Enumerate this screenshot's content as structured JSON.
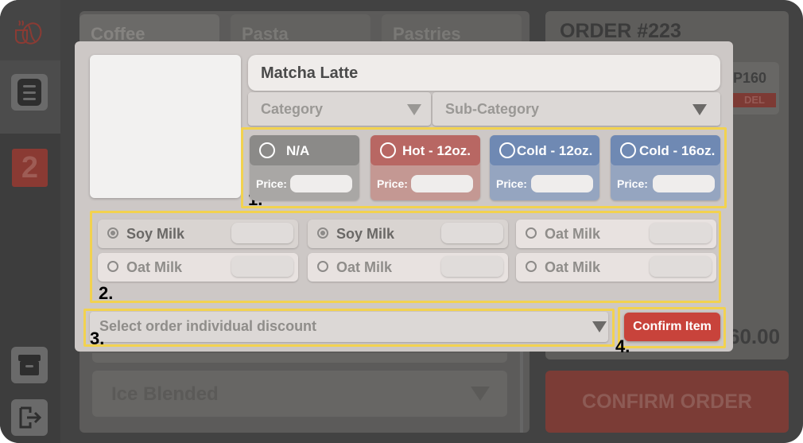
{
  "modal": {
    "item_name": "Matcha Latte",
    "category_placeholder": "Category",
    "subcategory_placeholder": "Sub-Category",
    "sizes": [
      {
        "label": "N/A",
        "price_label": "Price:",
        "color": "#8b8a88"
      },
      {
        "label": "Hot - 12oz.",
        "price_label": "Price:",
        "color": "#b86763"
      },
      {
        "label": "Cold - 12oz.",
        "price_label": "Price:",
        "color": "#6f89b3"
      },
      {
        "label": "Cold - 16oz.",
        "price_label": "Price:",
        "color": "#6f89b3"
      }
    ],
    "addons": [
      {
        "label": "Soy Milk",
        "selected": true
      },
      {
        "label": "Soy Milk",
        "selected": true
      },
      {
        "label": "Oat Milk",
        "selected": false
      },
      {
        "label": "Oat Milk",
        "selected": false
      },
      {
        "label": "Oat Milk",
        "selected": false
      },
      {
        "label": "Oat Milk",
        "selected": false
      }
    ],
    "discount_placeholder": "Select order individual discount",
    "confirm_item_label": "Confirm Item",
    "callouts": [
      "1.",
      "2.",
      "3.",
      "4."
    ],
    "accent_color": "#c8433b",
    "highlight_color": "#f2d24f"
  },
  "background": {
    "tabs": [
      "Coffee",
      "Pasta",
      "Pastries"
    ],
    "ice_blended_label": "Ice Blended",
    "order_title": "ORDER #223",
    "order_item_price": "P160",
    "order_item_action": "DEL",
    "order_total": "60.00",
    "confirm_order_label": "CONFIRM ORDER",
    "badge_count": "2"
  }
}
